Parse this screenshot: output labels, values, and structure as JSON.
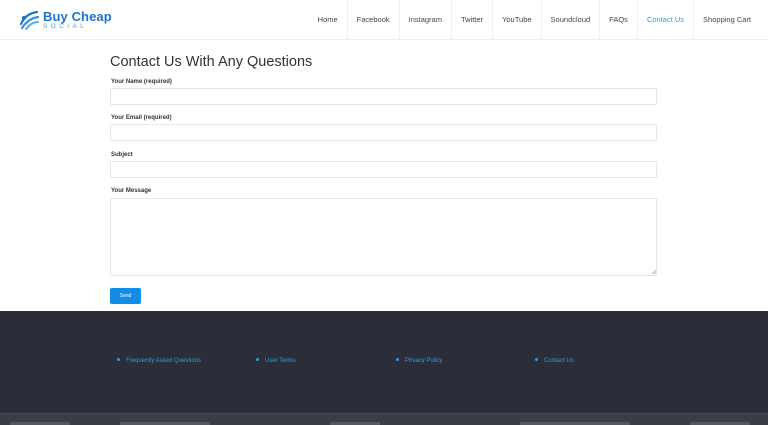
{
  "logo": {
    "title": "Buy Cheap",
    "subtitle": "SOCIAL",
    "icon": "globe-swoosh-logo"
  },
  "nav": {
    "items": [
      {
        "label": "Home"
      },
      {
        "label": "Facebook"
      },
      {
        "label": "Instagram"
      },
      {
        "label": "Twitter"
      },
      {
        "label": "YouTube"
      },
      {
        "label": "Soundcloud"
      },
      {
        "label": "FAQs"
      },
      {
        "label": "Contact Us",
        "active": true
      },
      {
        "label": "Shopping Cart"
      }
    ]
  },
  "form": {
    "title": "Contact Us With Any Questions",
    "name_label": "Your Name (required)",
    "name_value": "",
    "email_label": "Your Email (required)",
    "email_value": "",
    "subject_label": "Subject",
    "subject_value": "",
    "message_label": "Your Message",
    "message_value": "",
    "send_label": "Send"
  },
  "footer": {
    "links": [
      {
        "label": "Frequently Asked Questions"
      },
      {
        "label": "User Terms"
      },
      {
        "label": "Privacy Policy"
      },
      {
        "label": "Contact Us"
      }
    ]
  },
  "colors": {
    "accent": "#2a9ee8",
    "button": "#0f8de9",
    "footer_bg": "#2b2e38",
    "logo_blue": "#1c76c8"
  }
}
